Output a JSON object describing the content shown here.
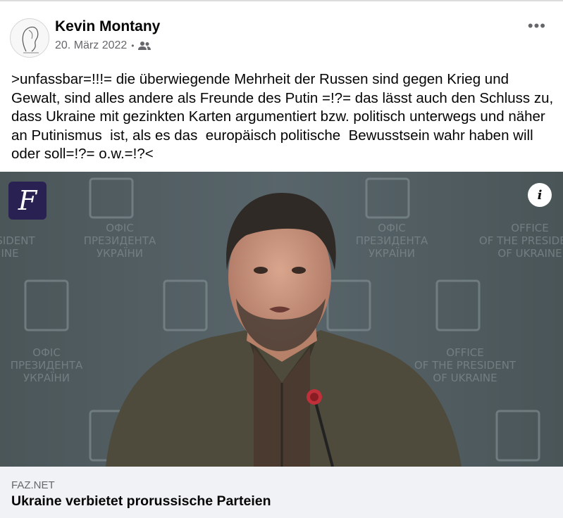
{
  "post": {
    "author": "Kevin Montany",
    "date": "20. März 2022",
    "separator": "•",
    "audience_icon": "friends-icon",
    "more_icon": "more-options-icon",
    "more_label": "•••",
    "text": ">unfassbar=!!!= die überwiegende Mehrheit der Russen sind gegen Krieg und Gewalt, sind alles andere als Freunde des Putin =!?= das lässt auch den Schluss zu, dass Ukraine mit gezinkten Karten argumentiert bzw. politisch unterwegs und näher an Putinismus  ist, als es das  europäisch politische  Bewusstsein wahr haben will oder soll=!?= o.w.=!?<"
  },
  "image": {
    "badge_letter": "F",
    "info_label": "i",
    "backdrop_text": {
      "ua_line1": "ОФІС",
      "ua_line2": "ПРЕЗИДЕНТА",
      "ua_line3": "УКРАЇНИ",
      "en_line1": "OFFICE",
      "en_line2": "OF THE PRESIDENT",
      "en_line3": "OF UKRAINE",
      "partial_en1": "SIDENT",
      "partial_en2": "INE"
    }
  },
  "link_preview": {
    "domain": "FAZ.NET",
    "title": "Ukraine verbietet prorussische Parteien"
  },
  "colors": {
    "secondary_text": "#65676b",
    "link_box_bg": "#f0f2f5",
    "brand_badge": "#2a2153"
  }
}
